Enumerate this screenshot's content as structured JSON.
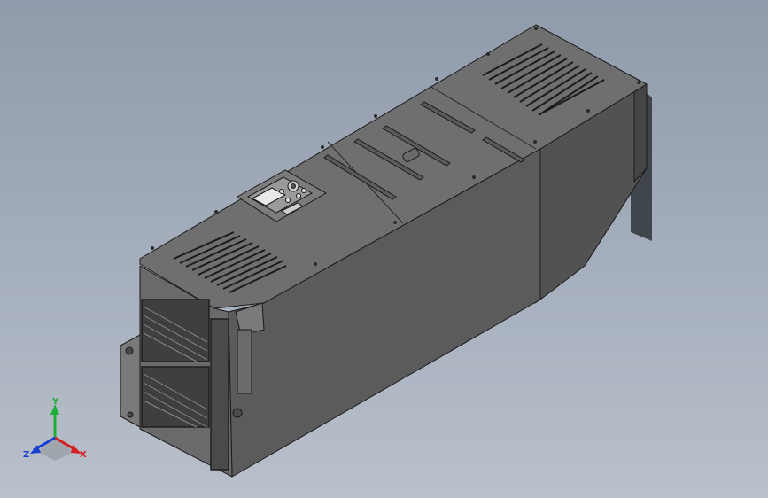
{
  "viewport": {
    "background_top": "#8f9aab",
    "background_bottom": "#b9c0cb",
    "model_colors": {
      "top_face": "#6f6f6f",
      "front_face": "#5c5c5c",
      "side_face": "#4d4d4d",
      "edge": "#1a1a1a",
      "shadow": "#2e3438"
    },
    "model_components": [
      "enclosure-body",
      "heatsink-duct",
      "keypad-panel",
      "top-vent-grille",
      "rear-vent-grille",
      "side-vent-grille",
      "mounting-bracket"
    ]
  },
  "triad": {
    "x_label": "X",
    "y_label": "Y",
    "z_label": "Z",
    "x_color": "#d62020",
    "y_color": "#1fae35",
    "z_color": "#1a3fd0"
  }
}
